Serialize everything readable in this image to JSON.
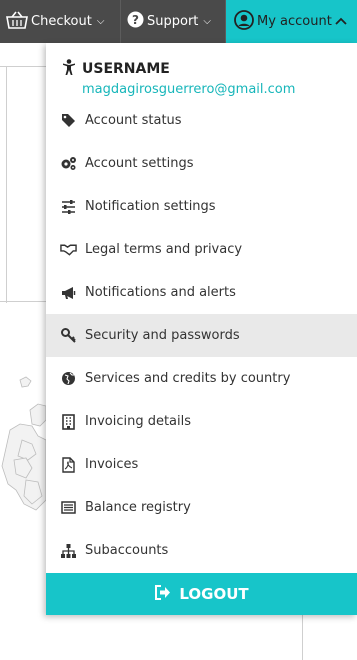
{
  "nav": {
    "checkout_label": "Checkout",
    "support_label": "Support",
    "account_label": "My account"
  },
  "user": {
    "username": "USERNAME",
    "email": "magdagirosguerrero@gmail.com"
  },
  "menu": {
    "items": [
      {
        "label": "Account status",
        "icon": "tag-icon"
      },
      {
        "label": "Account settings",
        "icon": "gears-icon"
      },
      {
        "label": "Notification settings",
        "icon": "sliders-icon"
      },
      {
        "label": "Legal terms and privacy",
        "icon": "handshake-icon"
      },
      {
        "label": "Notifications and alerts",
        "icon": "megaphone-icon"
      },
      {
        "label": "Security and passwords",
        "icon": "key-icon"
      },
      {
        "label": "Services and credits by country",
        "icon": "globe-icon"
      },
      {
        "label": "Invoicing details",
        "icon": "building-icon"
      },
      {
        "label": "Invoices",
        "icon": "pdf-file-icon"
      },
      {
        "label": "Balance registry",
        "icon": "list-icon"
      },
      {
        "label": "Subaccounts",
        "icon": "sitemap-icon"
      }
    ],
    "highlighted_index": 5
  },
  "logout_label": "LOGOUT",
  "colors": {
    "accent": "#17c5c9",
    "topbar": "#4a4a4a",
    "email": "#17b6ba",
    "hover": "#e9e9e9"
  }
}
